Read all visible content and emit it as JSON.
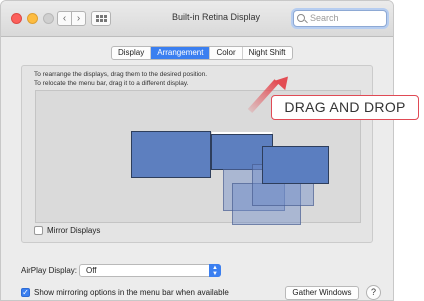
{
  "window": {
    "title": "Built-in Retina Display"
  },
  "toolbar": {
    "back_icon": "chevron-left-icon",
    "forward_icon": "chevron-right-icon",
    "grid_icon": "show-all-grid-icon",
    "back_glyph": "‹",
    "forward_glyph": "›"
  },
  "search": {
    "placeholder": "Search",
    "icon": "search-icon"
  },
  "tabs": [
    {
      "label": "Display",
      "active": false
    },
    {
      "label": "Arrangement",
      "active": true
    },
    {
      "label": "Color",
      "active": false
    },
    {
      "label": "Night Shift",
      "active": false
    }
  ],
  "instructions": {
    "line1": "To rearrange the displays, drag them to the desired position.",
    "line2": "To relocate the menu bar, drag it to a different display."
  },
  "overlay": {
    "label": "DRAG AND DROP",
    "accent": "#e34d54"
  },
  "mirror": {
    "label": "Mirror Displays",
    "checked": false
  },
  "airplay": {
    "label": "AirPlay Display:",
    "value": "Off"
  },
  "mirroring_option": {
    "label": "Show mirroring options in the menu bar when available",
    "checked": true,
    "check_glyph": "✓"
  },
  "buttons": {
    "gather": "Gather Windows",
    "help": "?"
  },
  "colors": {
    "accent": "#3b7ff0",
    "display_fill": "#5d7fbf"
  }
}
